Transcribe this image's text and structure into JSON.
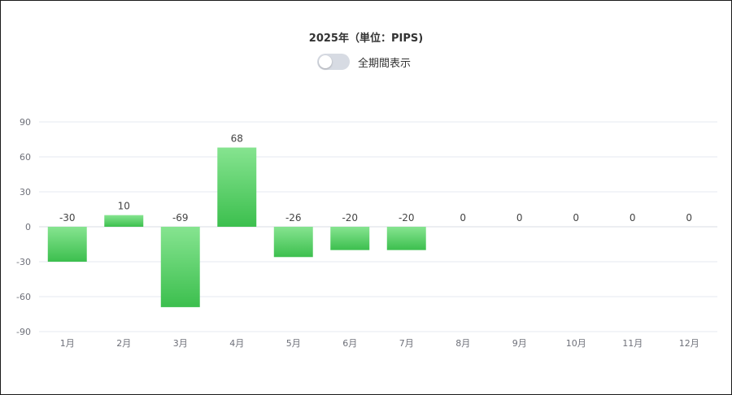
{
  "header": {
    "toggle_label": "全期間表示",
    "toggle_on": false
  },
  "colors": {
    "bar_top": "#86e490",
    "bar_bottom": "#3cbf4e",
    "grid": "#e6e9f0",
    "tick_text": "#6e7079",
    "label_text": "#444444"
  },
  "chart_data": {
    "type": "bar",
    "title": "2025年（単位：PIPS)",
    "categories": [
      "1月",
      "2月",
      "3月",
      "4月",
      "5月",
      "6月",
      "7月",
      "8月",
      "9月",
      "10月",
      "11月",
      "12月"
    ],
    "values": [
      -30,
      10,
      -69,
      68,
      -26,
      -20,
      -20,
      0,
      0,
      0,
      0,
      0
    ],
    "ylim": [
      -90,
      90
    ],
    "yticks": [
      90,
      60,
      30,
      0,
      -30,
      -60,
      -90
    ],
    "grid": true,
    "data_labels": true
  }
}
